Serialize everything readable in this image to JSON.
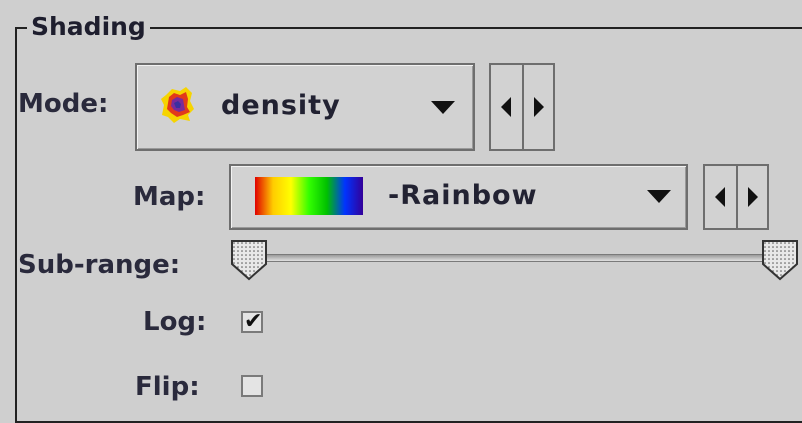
{
  "shading": {
    "title": "Shading",
    "mode": {
      "label": "Mode:",
      "value": "density",
      "icon": "density-blob-icon"
    },
    "map": {
      "label": "Map:",
      "value": "-Rainbow",
      "swatch_colors": [
        "#e00000",
        "#ffcc00",
        "#ffff00",
        "#33ff00",
        "#00c000",
        "#0033ff",
        "#330099"
      ]
    },
    "sub_range": {
      "label": "Sub-range:",
      "low": 0.0,
      "high": 1.0
    },
    "log": {
      "label": "Log:",
      "checked": true,
      "checkmark": "✔"
    },
    "flip": {
      "label": "Flip:",
      "checked": false
    }
  }
}
